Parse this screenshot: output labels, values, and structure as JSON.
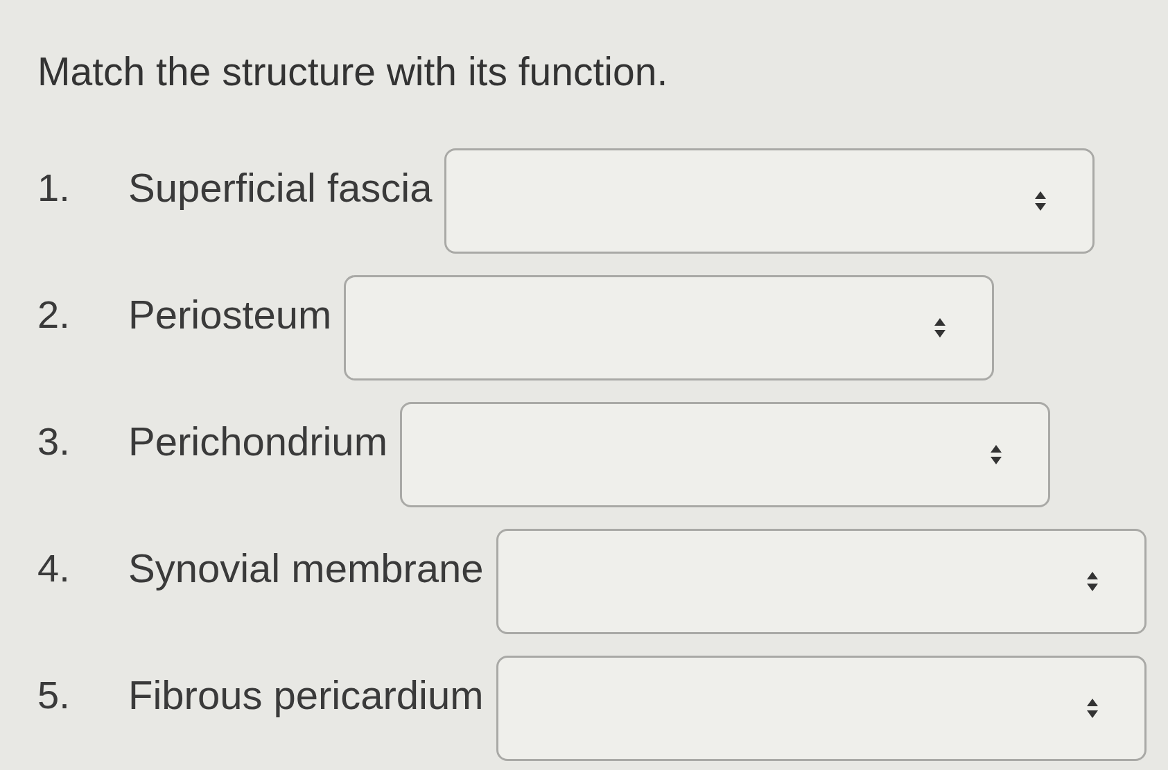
{
  "question": {
    "prompt": "Match the structure with its function."
  },
  "items": [
    {
      "number": "1.",
      "label": "Superficial fascia"
    },
    {
      "number": "2.",
      "label": "Periosteum"
    },
    {
      "number": "3.",
      "label": "Perichondrium"
    },
    {
      "number": "4.",
      "label": "Synovial membrane"
    },
    {
      "number": "5.",
      "label": "Fibrous pericardium"
    }
  ]
}
